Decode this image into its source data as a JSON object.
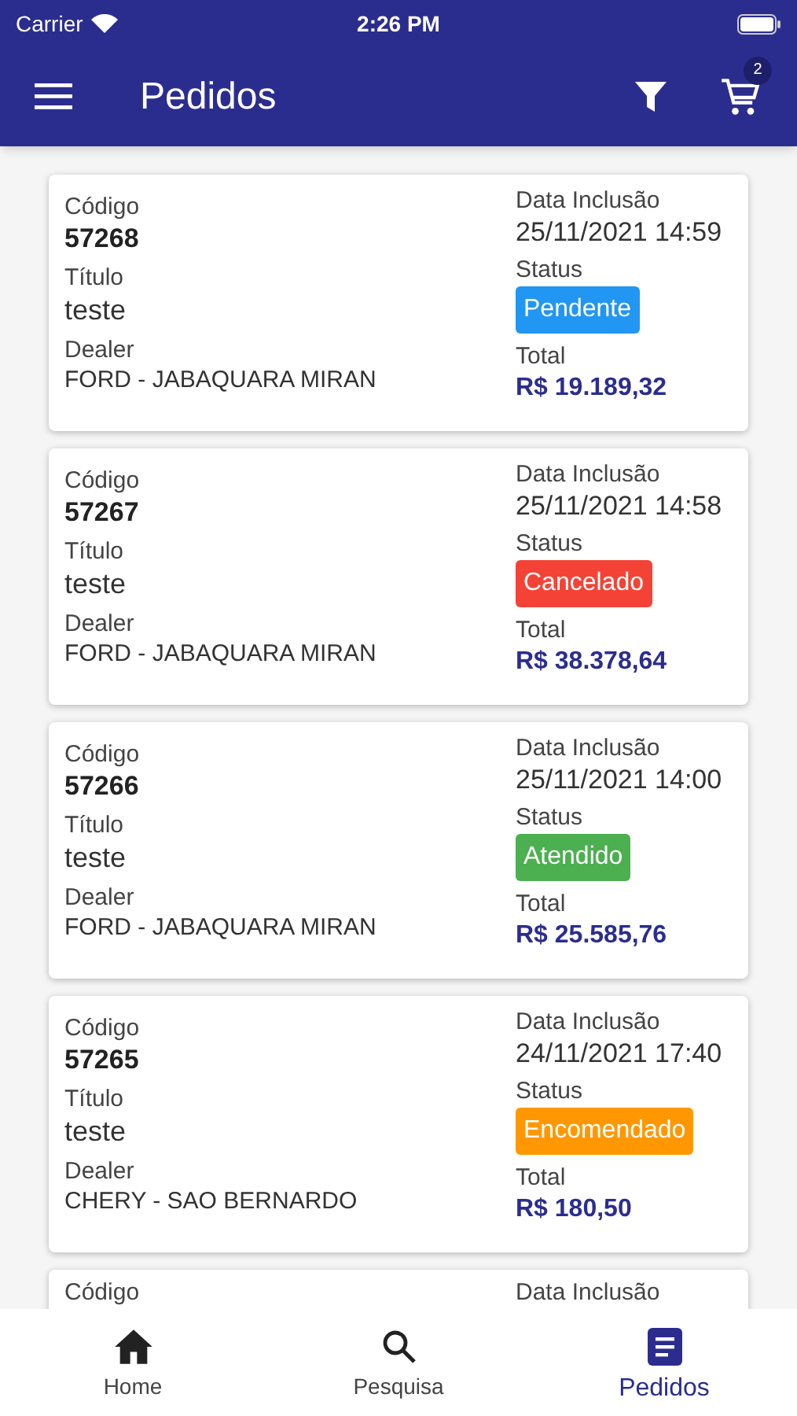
{
  "status_bar": {
    "carrier": "Carrier",
    "time": "2:26 PM"
  },
  "app_bar": {
    "title": "Pedidos",
    "cart_count": "2"
  },
  "orders": [
    {
      "code_label": "Código",
      "code": "57268",
      "title_label": "Título",
      "title": "teste",
      "dealer_label": "Dealer",
      "dealer": "FORD - JABAQUARA MIRAN",
      "date_label": "Data Inclusão",
      "date": "25/11/2021 14:59",
      "status_label": "Status",
      "status": "Pendente",
      "color": "#2196f3",
      "total_label": "Total",
      "total": "R$ 19.189,32"
    },
    {
      "code_label": "Código",
      "code": "57267",
      "title_label": "Título",
      "title": "teste",
      "dealer_label": "Dealer",
      "dealer": "FORD - JABAQUARA MIRAN",
      "date_label": "Data Inclusão",
      "date": "25/11/2021 14:58",
      "status_label": "Status",
      "status": "Cancelado",
      "color": "#f44336",
      "total_label": "Total",
      "total": "R$ 38.378,64"
    },
    {
      "code_label": "Código",
      "code": "57266",
      "title_label": "Título",
      "title": "teste",
      "dealer_label": "Dealer",
      "dealer": "FORD - JABAQUARA MIRAN",
      "date_label": "Data Inclusão",
      "date": "25/11/2021 14:00",
      "status_label": "Status",
      "status": "Atendido",
      "color": "#4caf50",
      "total_label": "Total",
      "total": "R$ 25.585,76"
    },
    {
      "code_label": "Código",
      "code": "57265",
      "title_label": "Título",
      "title": "teste",
      "dealer_label": "Dealer",
      "dealer": "CHERY - SAO BERNARDO",
      "date_label": "Data Inclusão",
      "date": "24/11/2021 17:40",
      "status_label": "Status",
      "status": "Encomendado",
      "color": "#ff9800",
      "total_label": "Total",
      "total": "R$ 180,50"
    }
  ],
  "partial_order": {
    "code_label": "Código",
    "date_label": "Data Inclusão"
  },
  "bottom_nav": [
    {
      "label": "Home",
      "kind": "home",
      "selected": false
    },
    {
      "label": "Pesquisa",
      "kind": "search",
      "selected": false
    },
    {
      "label": "Pedidos",
      "kind": "orders",
      "selected": true
    }
  ]
}
